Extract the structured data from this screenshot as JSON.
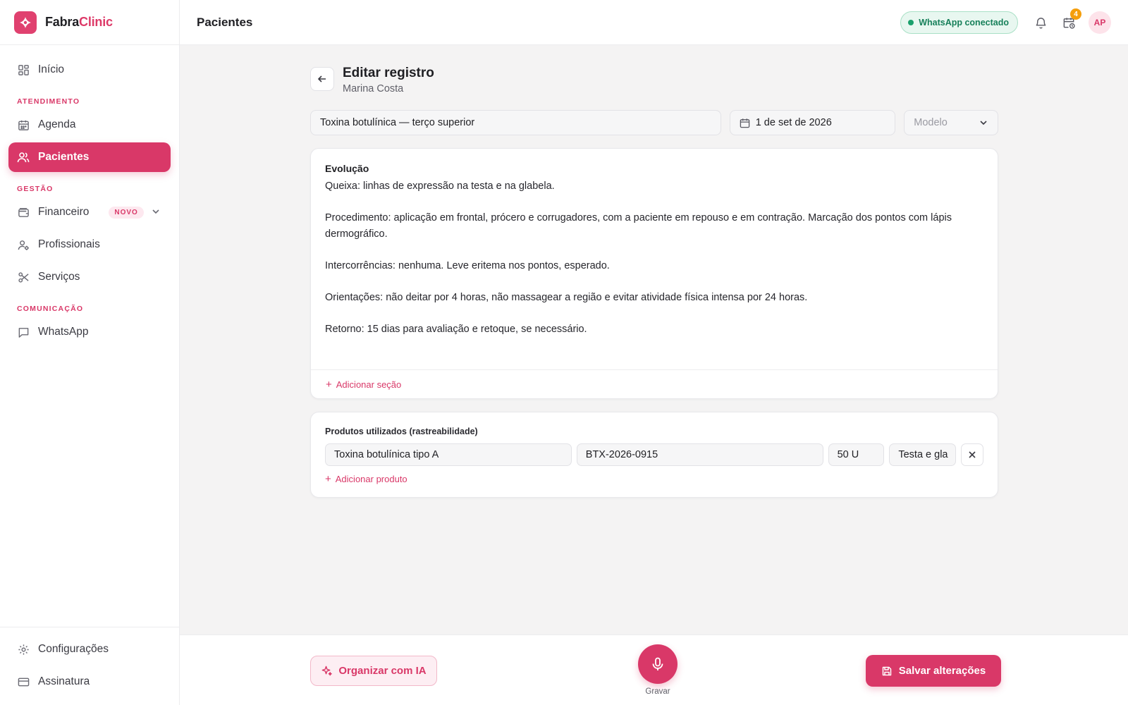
{
  "brand": {
    "name_part1": "Fabra",
    "name_part2": "Clinic",
    "accent": "#d93868"
  },
  "sidebar": {
    "home": {
      "label": "Início",
      "icon": "grid-icon"
    },
    "sections": {
      "atendimento": "ATENDIMENTO",
      "gestao": "GESTÃO",
      "comunicacao": "COMUNICAÇÃO"
    },
    "agenda": {
      "label": "Agenda",
      "icon": "calendar-icon"
    },
    "pacientes": {
      "label": "Pacientes",
      "icon": "users-icon",
      "active": true
    },
    "financeiro": {
      "label": "Financeiro",
      "badge": "NOVO",
      "icon": "wallet-icon"
    },
    "profissionais": {
      "label": "Profissionais",
      "icon": "user-gear-icon"
    },
    "servicos": {
      "label": "Serviços",
      "icon": "scissors-icon"
    },
    "whatsapp": {
      "label": "WhatsApp",
      "icon": "message-icon"
    },
    "configuracoes": {
      "label": "Configurações",
      "icon": "gear-icon"
    },
    "assinatura": {
      "label": "Assinatura",
      "icon": "credit-card-icon"
    }
  },
  "topbar": {
    "title": "Pacientes",
    "whatsapp_status": "WhatsApp conectado",
    "notifications_count": "4",
    "avatar_initials": "AP"
  },
  "record": {
    "heading": "Editar registro",
    "patient": "Marina Costa",
    "title_value": "Toxina botulínica — terço superior",
    "date_value": "1 de set de 2026",
    "model_placeholder": "Modelo"
  },
  "evolution": {
    "title": "Evolução",
    "text": "Queixa: linhas de expressão na testa e na glabela.\n\nProcedimento: aplicação em frontal, prócero e corrugadores, com a paciente em repouso e em contração. Marcação dos pontos com lápis dermográfico.\n\nIntercorrências: nenhuma. Leve eritema nos pontos, esperado.\n\nOrientações: não deitar por 4 horas, não massagear a região e evitar atividade física intensa por 24 horas.\n\nRetorno: 15 dias para avaliação e retoque, se necessário.",
    "add_section": "Adicionar seção"
  },
  "products": {
    "title": "Produtos utilizados (rastreabilidade)",
    "items": [
      {
        "name": "Toxina botulínica tipo A",
        "lot": "BTX-2026-0915",
        "quantity": "50 U",
        "area": "Testa e gla"
      }
    ],
    "add_product": "Adicionar produto"
  },
  "actions": {
    "organize_ai": "Organizar com IA",
    "record": "Gravar",
    "save": "Salvar alterações"
  }
}
